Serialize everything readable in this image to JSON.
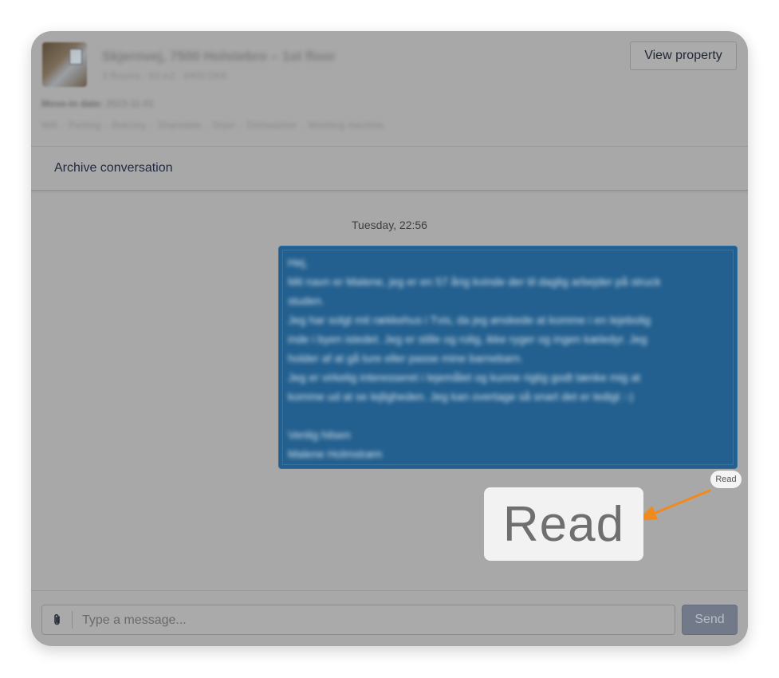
{
  "property": {
    "address": "Skjernvej, 7500 Holstebro – 1st floor",
    "meta": "3 Rooms · 83 m2 · 8400 DKK",
    "move_in_label": "Move-in date:",
    "move_in_value": "2023-11-01",
    "amenities": [
      "Wifi",
      "Parking",
      "Balcony",
      "Shareable",
      "Dryer",
      "Dishwasher",
      "Washing machine"
    ],
    "view_button": "View property"
  },
  "archive_label": "Archive conversation",
  "conversation": {
    "timestamp": "Tuesday, 22:56",
    "message_lines": [
      "Hej,",
      "Mit navn er Malene, jeg er en 57 årig kvinde der til daglig arbejder på struck",
      "studen.",
      "Jeg har solgt mit rækkehus i Tvis, da jeg ønskede at komme i en lejebolig",
      "inde i byen istedet. Jeg er stille og rolig, ikke ryger og ingen kæledyr. Jeg",
      "holder af at gå ture eller passe mine barnebarn.",
      "Jeg er virkelig interesseret i lejemålet og kunne rigtig godt tænke mig at",
      "komme ud at se lejligheden. Jeg kan overtage så snart det er ledigt :-)",
      "",
      "Venlig hilsen",
      "Malene Holmstrøm"
    ],
    "status": "Read",
    "status_zoomed": "Read"
  },
  "composer": {
    "placeholder": "Type a message...",
    "send_label": "Send"
  },
  "colors": {
    "overlay": "#a8a8a8",
    "bubble": "#23608f",
    "send_button": "#727a8a",
    "arrow": "#f08a1c"
  }
}
